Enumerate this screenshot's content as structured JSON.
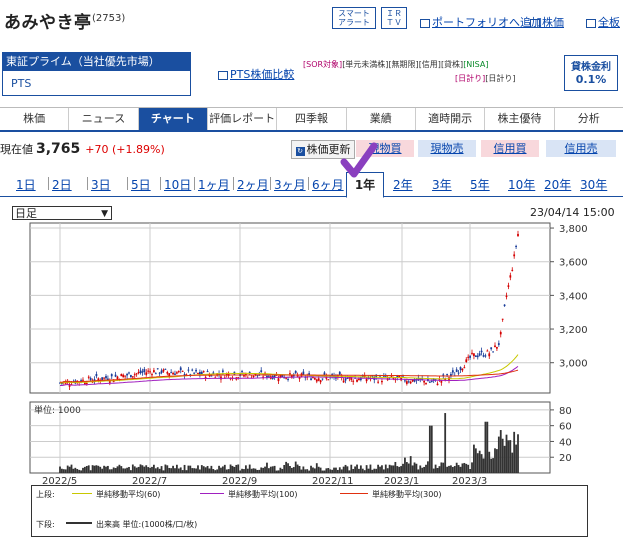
{
  "stock": {
    "name": "あみやき亭",
    "code": "(2753)"
  },
  "header_links": {
    "smart_alert": "スマート\nアラート",
    "smart_alert_l1": "スマート",
    "smart_alert_l2": "アラート",
    "ir_l1": "ＩＲ",
    "ir_l2": "ＴＶ",
    "portfolio": "ポートフォリオへ追加",
    "kabuka": "株価",
    "zenban": "全板"
  },
  "market": {
    "primary": "東証プライム（当社優先市場）",
    "pts": "PTS",
    "pts_compare": "PTS株価比較"
  },
  "tags": {
    "line1": [
      "[SOR対象]",
      "[単元未満株]",
      "[無期限]",
      "[信用]",
      "[貸株]",
      "[NISA]"
    ],
    "line2": [
      "[日計り]",
      "[日計り]"
    ]
  },
  "loan": {
    "label": "貸株金利",
    "value": "0.1%"
  },
  "tabs": [
    {
      "label": "株価",
      "active": false
    },
    {
      "label": "ニュース",
      "active": false
    },
    {
      "label": "チャート",
      "active": true
    },
    {
      "label": "評価レポート",
      "active": false
    },
    {
      "label": "四季報",
      "active": false
    },
    {
      "label": "業績",
      "active": false
    },
    {
      "label": "適時開示",
      "active": false
    },
    {
      "label": "株主優待",
      "active": false
    },
    {
      "label": "分析",
      "active": false
    }
  ],
  "price": {
    "label": "現在値",
    "value": "3,765",
    "change": "+70 (+1.89%)"
  },
  "actions": {
    "update": "株価更新",
    "gen_buy": "現物買",
    "gen_sell": "現物売",
    "shin_buy": "信用買",
    "shin_sell": "信用売"
  },
  "periods": [
    "1日",
    "2日",
    "3日",
    "5日",
    "10日",
    "1ヶ月",
    "2ヶ月",
    "3ヶ月",
    "6ヶ月",
    "1年",
    "2年",
    "3年",
    "5年",
    "10年",
    "20年",
    "30年"
  ],
  "active_period": "1年",
  "chart": {
    "interval_select": "日足",
    "timestamp": "23/04/14 15:00",
    "volume_unit_label": "単位: 1000",
    "legend_upper_label": "上段:",
    "legend_lower_label": "下段:",
    "legend_volume": "出来高 単位:(1000株/口/枚)",
    "colors": {
      "up": "#d40000",
      "down": "#1a3d99",
      "ma60": "#c8c800",
      "ma100": "#a020c0",
      "ma300": "#e03010",
      "volume": "#333333"
    }
  },
  "chart_data": [
    {
      "type": "candlestick",
      "title": "",
      "y_ticks": [
        3000,
        3200,
        3400,
        3600,
        3800
      ],
      "ylim": [
        2820,
        3830
      ],
      "x_tick_labels": [
        "2022/5",
        "2022/7",
        "2022/9",
        "2022/11",
        "2023/1",
        "2023/3"
      ],
      "series": [
        {
          "name": "単純移動平均(60)",
          "values": []
        },
        {
          "name": "単純移動平均(100)",
          "values": []
        },
        {
          "name": "単純移動平均(300)",
          "values": []
        }
      ],
      "approx_close_path": [
        {
          "x": "2022/4",
          "y": 2900
        },
        {
          "x": "2022/5",
          "y": 2920
        },
        {
          "x": "2022/6",
          "y": 2960
        },
        {
          "x": "2022/7",
          "y": 2950
        },
        {
          "x": "2022/8",
          "y": 2930
        },
        {
          "x": "2022/9",
          "y": 2920
        },
        {
          "x": "2022/10",
          "y": 2910
        },
        {
          "x": "2022/11",
          "y": 2900
        },
        {
          "x": "2022/12",
          "y": 2910
        },
        {
          "x": "2023/1",
          "y": 2890
        },
        {
          "x": "2023/2",
          "y": 2990
        },
        {
          "x": "2023/3",
          "y": 3060
        },
        {
          "x": "2023/3 late",
          "y": 3150
        },
        {
          "x": "2023/4",
          "y": 3600
        },
        {
          "x": "2023/4/14",
          "y": 3765
        }
      ]
    },
    {
      "type": "bar",
      "title": "",
      "ylabel": "単位: 1000",
      "y_ticks": [
        20,
        40,
        60,
        80
      ],
      "ylim": [
        0,
        90
      ]
    }
  ]
}
